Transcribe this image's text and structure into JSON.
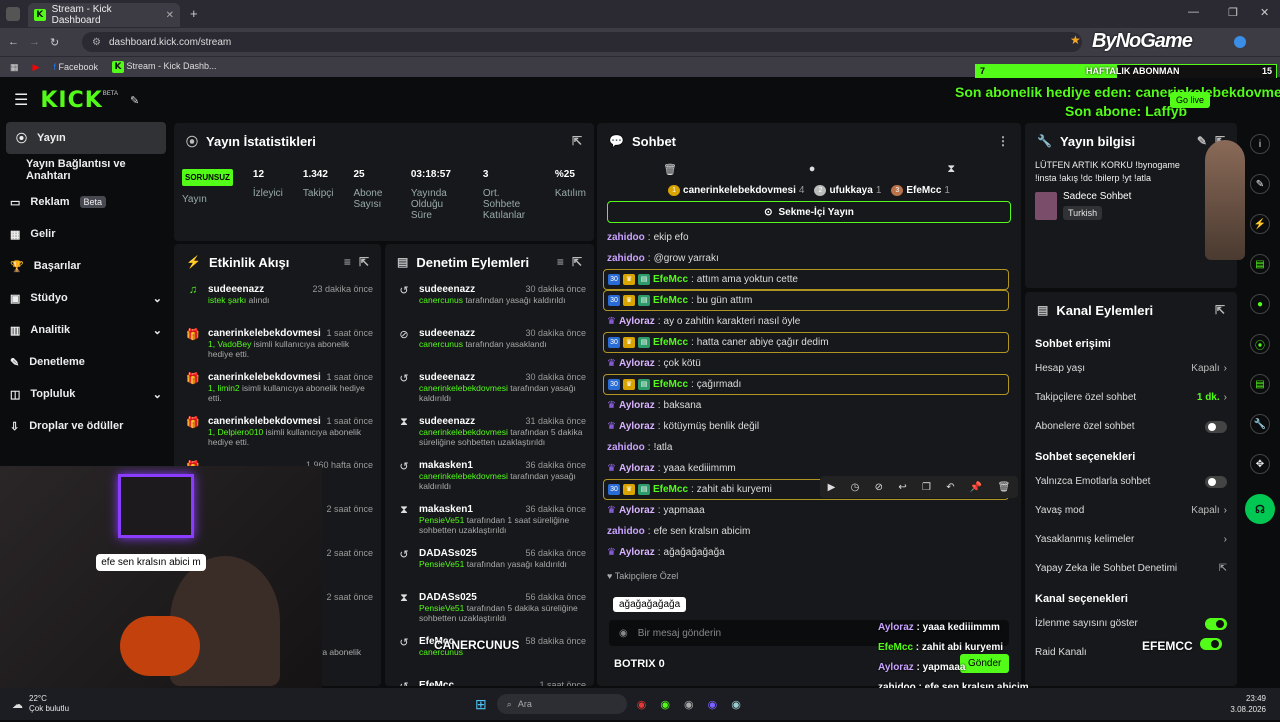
{
  "browser": {
    "tab_title": "Stream - Kick Dashboard",
    "url": "dashboard.kick.com/stream",
    "bookmarks": [
      "Facebook",
      "Stream - Kick Dashb..."
    ],
    "bookmarks_right": "Tüm Yer İşaretleri"
  },
  "overlay": {
    "weekly_label": "HAFTALIK ABONMAN",
    "weekly_left": "7",
    "weekly_right": "15",
    "weekly_progress": 0.47,
    "gift_line": "Son abonelik hediye eden: canerinkelebekdovmesi",
    "last_sub": "Son abone: Laffyb",
    "bynogame": "ByNoGame",
    "go_live": "Go live",
    "bubble": "efe sen kralsın abici m",
    "camera_name": "CANERCUNUS",
    "botrix": "BOTRIX 0",
    "efemcc": "EFEMCC",
    "chat_overlay": [
      {
        "user": "Ayloraz",
        "msg": "yaaa kediiimmm"
      },
      {
        "user": "EfeMcc",
        "msg": "zahit abi kuryemi"
      },
      {
        "user": "Ayloraz",
        "msg": "yapmaaa"
      },
      {
        "user": "zahidoo",
        "msg": "efe sen kralsın abicim"
      },
      {
        "user": "Ayloraz",
        "msg": "ağağağağağa"
      }
    ]
  },
  "nav": {
    "logo": "KICK",
    "beta": "BETA",
    "items": [
      {
        "label": "Yayın",
        "icon": "stream-icon",
        "active": true
      },
      {
        "label": "Yayın Bağlantısı ve Anahtarı"
      },
      {
        "label": "Reklam",
        "badge": "Beta"
      },
      {
        "label": "Gelir"
      },
      {
        "label": "Başarılar"
      },
      {
        "label": "Stüdyo",
        "chevron": true
      },
      {
        "label": "Analitik",
        "chevron": true
      },
      {
        "label": "Denetleme"
      },
      {
        "label": "Topluluk",
        "chevron": true
      },
      {
        "label": "Droplar ve ödüller"
      }
    ]
  },
  "stats": {
    "title": "Yayın İstatistikleri",
    "status_badge": "SORUNSUZ",
    "items": [
      {
        "value": "",
        "label": "Yayın"
      },
      {
        "value": "12",
        "label": "İzleyici"
      },
      {
        "value": "1.342",
        "label": "Takipçi"
      },
      {
        "value": "25",
        "label": "Abone Sayısı"
      },
      {
        "value": "03:18:57",
        "label": "Yayında Olduğu Süre"
      },
      {
        "value": "3",
        "label": "Ort. Sohbete Katılanlar"
      },
      {
        "value": "%25",
        "label": "Katılım"
      }
    ]
  },
  "activity": {
    "title": "Etkinlik Akışı",
    "items": [
      {
        "name": "sudeeenazz",
        "time": "23 dakika önce",
        "sub_g": "istek şarkı",
        "sub": " alındı"
      },
      {
        "name": "canerinkelebekdovmesi",
        "time": "1 saat önce",
        "sub_g": "1, VadoBey",
        "sub": " isimli kullanıcıya abonelik hediye etti."
      },
      {
        "name": "canerinkelebekdovmesi",
        "time": "1 saat önce",
        "sub_g": "1, limin2",
        "sub": " isimli kullanıcıya abonelik hediye etti."
      },
      {
        "name": "canerinkelebekdovmesi",
        "time": "1 saat önce",
        "sub_g": "1, Delpiero010",
        "sub": " isimli kullanıcıya abonelik hediye etti."
      },
      {
        "name": "",
        "time": "1.960 hafta önce",
        "sub_g": "",
        "sub": ""
      },
      {
        "name": "",
        "time": "2 saat önce",
        "sub_g": "",
        "sub": ""
      },
      {
        "name": "",
        "time": "2 saat önce",
        "sub_g": "",
        "sub": "hediye"
      },
      {
        "name": "",
        "time": "2 saat önce",
        "sub_g": "",
        "sub": ""
      },
      {
        "name": "EfeMcc",
        "time": "",
        "sub_g": "1, salihumut67",
        "sub": " isimli kullanıcıya abonelik hediye etti."
      }
    ]
  },
  "moderation": {
    "title": "Denetim Eylemleri",
    "items": [
      {
        "name": "sudeeenazz",
        "time": "30 dakika önce",
        "sub_g": "canercunus",
        "sub": " tarafından yasağı kaldırıldı",
        "icon": "undo-icon"
      },
      {
        "name": "sudeeenazz",
        "time": "30 dakika önce",
        "sub_g": "canercunus",
        "sub": " tarafından yasaklandı",
        "icon": "ban-icon"
      },
      {
        "name": "sudeeenazz",
        "time": "30 dakika önce",
        "sub_g": "canerinkelebekdovmesi",
        "sub": " tarafından yasağı kaldırıldı",
        "icon": "undo-icon"
      },
      {
        "name": "sudeeenazz",
        "time": "31 dakika önce",
        "sub_g": "canerinkelebekdovmesi",
        "sub": " tarafından 5 dakika süreliğine sohbetten uzaklaştırıldı",
        "icon": "hourglass-icon"
      },
      {
        "name": "makasken1",
        "time": "36 dakika önce",
        "sub_g": "canerinkelebekdovmesi",
        "sub": " tarafından yasağı kaldırıldı",
        "icon": "undo-icon"
      },
      {
        "name": "makasken1",
        "time": "36 dakika önce",
        "sub_g": "PensieVe51",
        "sub": " tarafından 1 saat süreliğine sohbetten uzaklaştırıldı",
        "icon": "hourglass-icon"
      },
      {
        "name": "DADASs025",
        "time": "56 dakika önce",
        "sub_g": "PensieVe51",
        "sub": " tarafından yasağı kaldırıldı",
        "icon": "undo-icon"
      },
      {
        "name": "DADASs025",
        "time": "56 dakika önce",
        "sub_g": "PensieVe51",
        "sub": " tarafından 5 dakika süreliğine sohbetten uzaklaştırıldı",
        "icon": "hourglass-icon"
      },
      {
        "name": "EfeMcc",
        "time": "58 dakika önce",
        "sub_g": "canercunus",
        "sub": "",
        "icon": "undo-icon"
      },
      {
        "name": "EfeMcc",
        "time": "1 saat önce",
        "sub_g": "",
        "sub": "",
        "icon": "undo-icon"
      }
    ]
  },
  "chat": {
    "title": "Sohbet",
    "top_chatters": [
      {
        "rank": "1",
        "name": "canerinkelebekdovmesi",
        "count": "4"
      },
      {
        "rank": "2",
        "name": "ufukkaya",
        "count": "1"
      },
      {
        "rank": "3",
        "name": "EfeMcc",
        "count": "1"
      }
    ],
    "pinned": "Sekme-İçi Yayın",
    "messages": [
      {
        "user": "zahidoo",
        "msg": "ekip efo",
        "type": "u1"
      },
      {
        "user": "zahidoo",
        "msg": "@grow yarrakı",
        "type": "u1"
      },
      {
        "user": "EfeMcc",
        "msg": "attım ama yoktun cette",
        "type": "u2",
        "hl": true
      },
      {
        "user": "EfeMcc",
        "msg": "bu gün attım",
        "type": "u2",
        "hl": true
      },
      {
        "user": "Ayloraz",
        "msg": "ay o zahitin karakteri nasıl öyle",
        "type": "u3"
      },
      {
        "user": "EfeMcc",
        "msg": "hatta caner abiye çağır dedim",
        "type": "u2",
        "hl": true
      },
      {
        "user": "Ayloraz",
        "msg": "çok kötü",
        "type": "u3"
      },
      {
        "user": "EfeMcc",
        "msg": "çağırmadı",
        "type": "u2",
        "hl": true
      },
      {
        "user": "Ayloraz",
        "msg": "baksana",
        "type": "u3"
      },
      {
        "user": "Ayloraz",
        "msg": "kötüymüş benlik değil",
        "type": "u3"
      },
      {
        "user": "zahidoo",
        "msg": "!atla",
        "type": "u1"
      },
      {
        "user": "Ayloraz",
        "msg": "yaaa kediiimmm",
        "type": "u3"
      },
      {
        "user": "EfeMcc",
        "msg": "zahit abi kuryemi",
        "type": "u2",
        "hl": true
      },
      {
        "user": "Ayloraz",
        "msg": "yapmaaa",
        "type": "u3"
      },
      {
        "user": "zahidoo",
        "msg": "efe sen kralsın abicim",
        "type": "u1"
      },
      {
        "user": "Ayloraz",
        "msg": "ağağağağağa",
        "type": "u3"
      }
    ],
    "followers_only": "Takipçilere Özel",
    "tooltip": "ağağağağağa",
    "input_placeholder": "Bir mesaj gönderin",
    "send": "Gönder"
  },
  "stream_info": {
    "title": "Yayın bilgisi",
    "stream_title": "LÜTFEN ARTIK KORKU !bynogame !insta !akış !dc !bilerp !yt !atla",
    "category": "Sadece Sohbet",
    "tag": "Turkish"
  },
  "channel": {
    "title": "Kanal Eylemleri",
    "sec1": "Sohbet erişimi",
    "rows1": [
      {
        "label": "Hesap yaşı",
        "value": "Kapalı",
        "kind": "arrow"
      },
      {
        "label": "Takipçilere özel sohbet",
        "value": "1 dk.",
        "kind": "arrow-g"
      },
      {
        "label": "Abonelere özel sohbet",
        "value": "",
        "kind": "toggle"
      }
    ],
    "sec2": "Sohbet seçenekleri",
    "rows2": [
      {
        "label": "Yalnızca Emotlarla sohbet",
        "value": "",
        "kind": "toggle"
      },
      {
        "label": "Yavaş mod",
        "value": "Kapalı",
        "kind": "arrow"
      },
      {
        "label": "Yasaklanmış kelimeler",
        "value": "",
        "kind": "arrow"
      },
      {
        "label": "Yapay Zeka ile Sohbet Denetimi",
        "value": "",
        "kind": "ext"
      }
    ],
    "sec3": "Kanal seçenekleri",
    "rows3": [
      {
        "label": "İzlenme sayısını göster",
        "value": "",
        "kind": "toggle-on"
      },
      {
        "label": "Raid Kanalı",
        "value": "",
        "kind": "none"
      }
    ]
  },
  "taskbar": {
    "weather_temp": "22°C",
    "weather_desc": "Çok bulutlu",
    "search": "Ara",
    "time": "23:49",
    "date": "3.08.2026"
  }
}
